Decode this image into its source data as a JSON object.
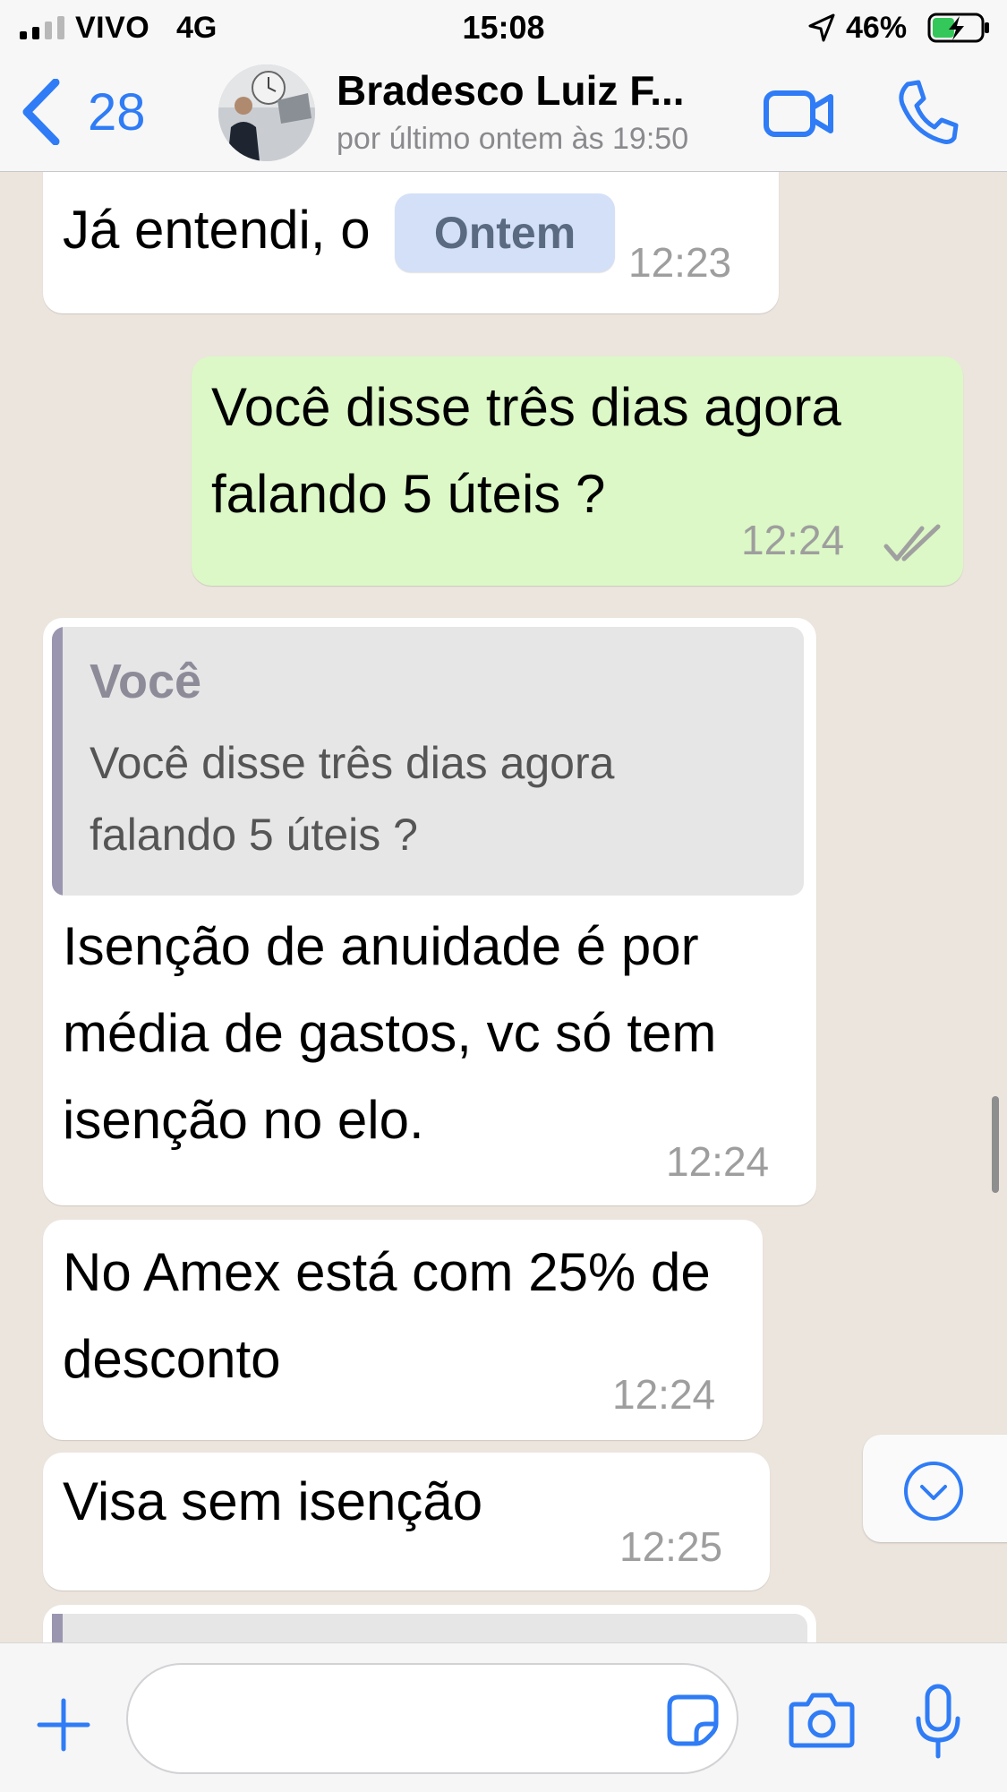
{
  "status_bar": {
    "carrier": "VIVO",
    "network": "4G",
    "time": "15:08",
    "battery": "46%",
    "battery_level": 0.46
  },
  "header": {
    "back_count": "28",
    "contact_name": "Bradesco Luiz F...",
    "contact_status": "por último ontem às 19:50"
  },
  "chat": {
    "date_chip": "Ontem",
    "messages": [
      {
        "direction": "in",
        "text": "Já entendi, o",
        "time": "12:23"
      },
      {
        "direction": "out",
        "text": "Você disse três dias agora falando 5 úteis ?",
        "time": "12:24",
        "read": true
      },
      {
        "direction": "in",
        "quote_author": "Você",
        "quote_text": "Você disse três dias agora falando 5 úteis ?",
        "text": "Isenção de anuidade é por média de gastos, vc só tem isenção no elo.",
        "time": "12:24"
      },
      {
        "direction": "in",
        "text": "No Amex está com 25% de desconto",
        "time": "12:24"
      },
      {
        "direction": "in",
        "text": "Visa sem isenção",
        "time": "12:25"
      }
    ]
  },
  "input_bar": {
    "placeholder": ""
  },
  "colors": {
    "accent": "#2f7cf6",
    "incoming_bubble": "#ffffff",
    "outgoing_bubble": "#dcf8c6",
    "chat_background": "#ece5dd",
    "date_chip": "#d4e0f7"
  },
  "icons": {
    "back": "chevron-left-icon",
    "video": "video-camera-icon",
    "call": "phone-icon",
    "plus": "plus-icon",
    "sticker": "sticker-icon",
    "camera": "camera-icon",
    "mic": "microphone-icon",
    "scroll_down": "chevron-down-circle-icon",
    "read": "double-check-icon"
  }
}
